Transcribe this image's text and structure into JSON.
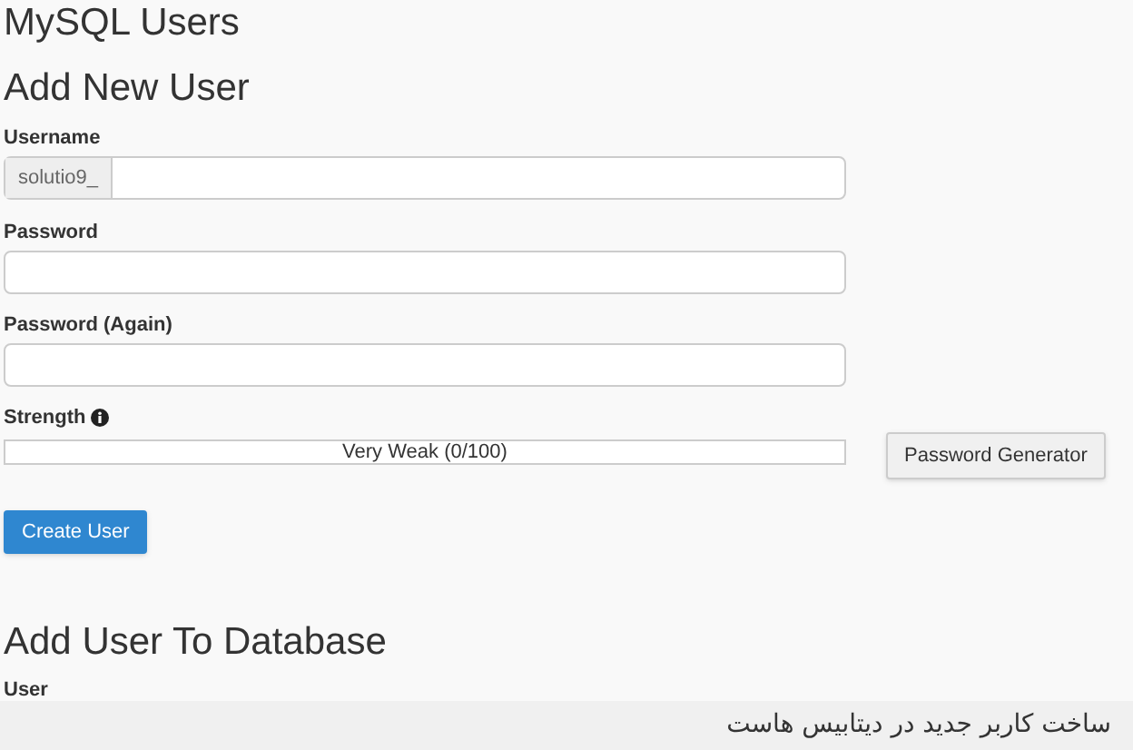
{
  "page_title": "MySQL Users",
  "add_user": {
    "heading": "Add New User",
    "username": {
      "label": "Username",
      "prefix": "solutio9_"
    },
    "password": {
      "label": "Password"
    },
    "password_again": {
      "label": "Password (Again)"
    },
    "strength": {
      "label": "Strength",
      "level": 0,
      "reading": "Very Weak (0/100)"
    },
    "generator_button": "Password Generator",
    "create_button": "Create User"
  },
  "add_to_database": {
    "heading": "Add User To Database",
    "user_label": "User"
  },
  "caption": "ساخت کاربر جدید در دیتابیس هاست"
}
